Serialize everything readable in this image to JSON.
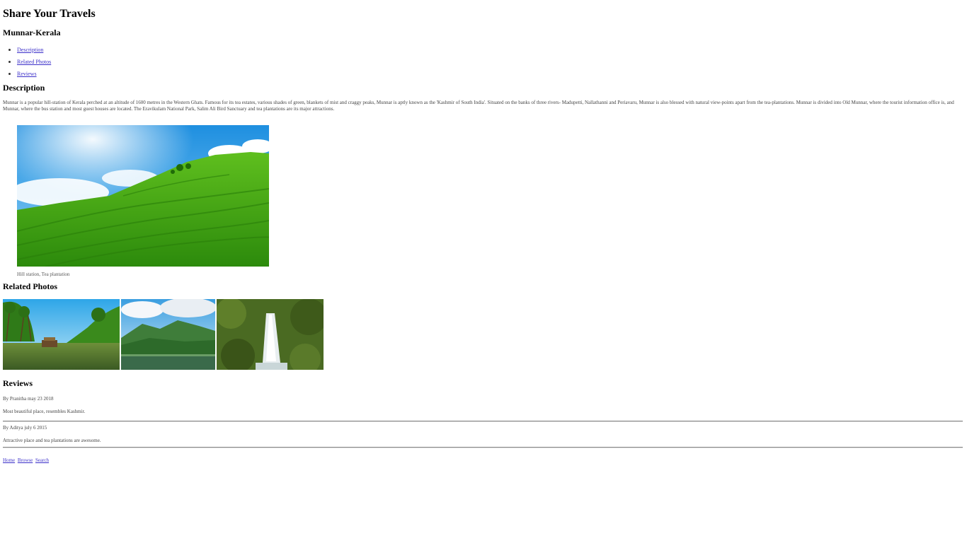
{
  "site_title": "Share Your Travels",
  "place_title": "Munnar-Kerala",
  "nav": {
    "items": [
      {
        "label": "Description"
      },
      {
        "label": "Related Photos"
      },
      {
        "label": "Reviews"
      }
    ]
  },
  "description": {
    "heading": "Description",
    "text": "Munnar is a popular hill-station of Kerala perched at an altitude of 1600 metres in the Western Ghats. Famous for its tea estates, various shades of green, blankets of mist and craggy peaks, Munnar is aptly known as the 'Kashmir of South India'. Situated on the banks of three rivers- Madupetti, Nallathanni and Periavaru, Munnar is also blessed with natural view-points apart from the tea-plantations. Munnar is divided into Old Munnar, where the tourist information office is, and Munnar, where the bus station and most guest houses are located. The Eravikulam National Park, Salim Ali Bird Sanctuary and tea plantations are its major attractions.",
    "image_caption": "Hill station, Tea plantation"
  },
  "related": {
    "heading": "Related Photos"
  },
  "reviews": {
    "heading": "Reviews",
    "items": [
      {
        "byline": "By Pranitha may 23 2018",
        "text": "Most beautiful place, resembles Kashmir."
      },
      {
        "byline": "By Aditya july 6 2015",
        "text": "Attractive place and tea plantations are awesome."
      }
    ]
  },
  "footer": {
    "links": [
      "Home",
      "Browse",
      "Search"
    ]
  }
}
